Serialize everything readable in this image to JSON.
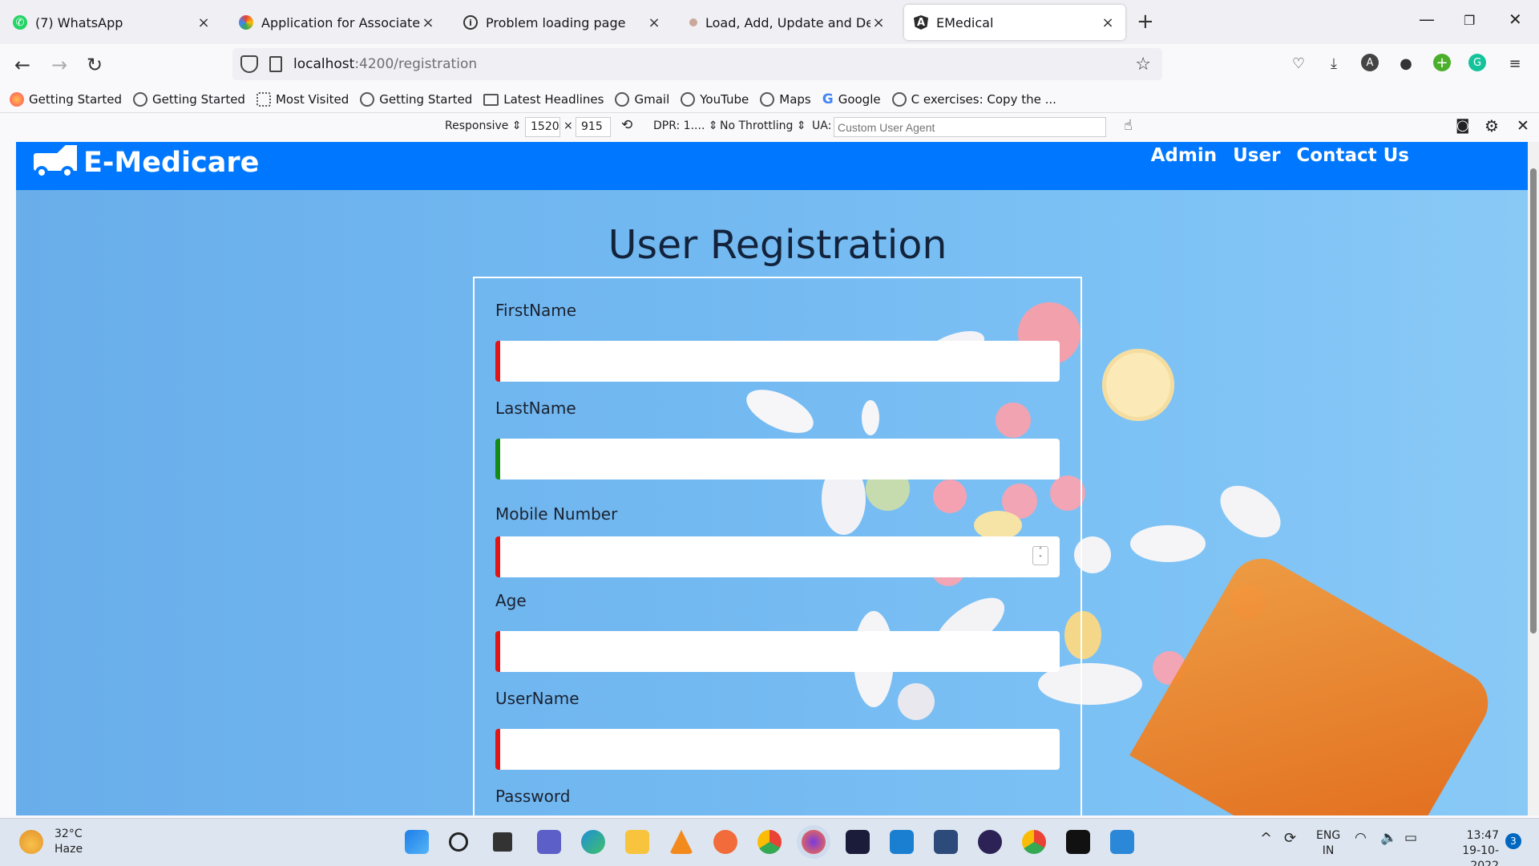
{
  "browser": {
    "tabs": [
      {
        "title": "(7) WhatsApp",
        "icon": "whatsapp-icon",
        "color": "#25d366",
        "glyph": "?"
      },
      {
        "title": "Application for Associate Softw",
        "icon": "multicolor-icon",
        "color": "#7b61ff",
        "glyph": "✿"
      },
      {
        "title": "Problem loading page",
        "icon": "info-icon",
        "color": "#fff",
        "glyph": "ⓘ"
      },
      {
        "title": "Load, Add, Update and Delete T",
        "icon": "avatar-icon",
        "color": "#b07b6a",
        "glyph": "•"
      },
      {
        "title": "EMedical",
        "icon": "angular-icon",
        "color": "#2b2b2b",
        "glyph": "A"
      }
    ],
    "url_host": "localhost",
    "url_path": ":4200/registration",
    "bookmarks": [
      {
        "label": "Getting Started",
        "icon": "firefox-icon"
      },
      {
        "label": "Getting Started",
        "icon": "globe-icon"
      },
      {
        "label": "Most Visited",
        "icon": "gear-icon"
      },
      {
        "label": "Getting Started",
        "icon": "globe-icon"
      },
      {
        "label": "Latest Headlines",
        "icon": "folder-icon"
      },
      {
        "label": "Gmail",
        "icon": "globe-icon"
      },
      {
        "label": "YouTube",
        "icon": "globe-icon"
      },
      {
        "label": "Maps",
        "icon": "globe-icon"
      },
      {
        "label": "Google",
        "icon": "google-icon"
      },
      {
        "label": "C exercises: Copy the ...",
        "icon": "globe-icon"
      }
    ],
    "rdm": {
      "device": "Responsive ⇕",
      "width": "1520",
      "times": "×",
      "height": "915",
      "dpr": "DPR: 1.... ⇕",
      "throttling": "No Throttling ⇕",
      "ua_label": "UA:",
      "ua_placeholder": "Custom User Agent"
    }
  },
  "app": {
    "brand": "E-Medicare",
    "nav": [
      "Admin",
      "User",
      "Contact Us"
    ],
    "page_title": "User Registration",
    "fields": [
      {
        "label": "FirstName",
        "state": "invalid"
      },
      {
        "label": "LastName",
        "state": "valid"
      },
      {
        "label": "Mobile Number",
        "state": "invalid"
      },
      {
        "label": "Age",
        "state": "invalid"
      },
      {
        "label": "UserName",
        "state": "invalid"
      },
      {
        "label": "Password",
        "state": "invalid"
      }
    ]
  },
  "taskbar": {
    "temperature": "32°C",
    "weather": "Haze",
    "lang1": "ENG",
    "lang2": "IN",
    "time": "13:47",
    "date": "19-10-2022",
    "notifications": "3"
  },
  "colors": {
    "app_nav": "#0077ff",
    "invalid": "#e01515",
    "valid": "#168a16"
  }
}
